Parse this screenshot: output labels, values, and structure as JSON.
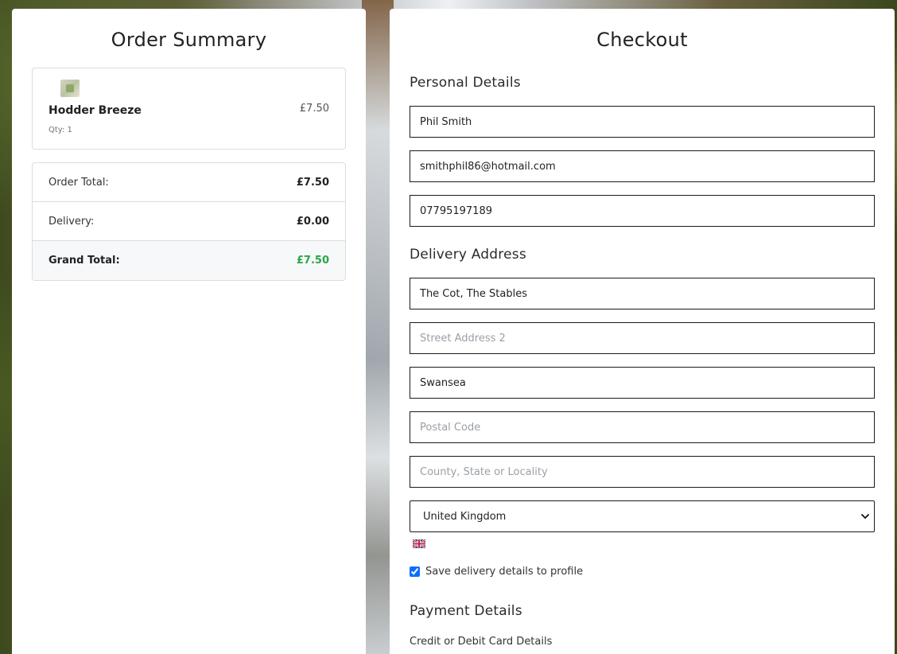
{
  "summary": {
    "title": "Order Summary",
    "item": {
      "name": "Hodder Breeze",
      "qty": "Qty: 1",
      "price": "£7.50"
    },
    "totals": {
      "order_total_label": "Order Total:",
      "order_total_value": "£7.50",
      "delivery_label": "Delivery:",
      "delivery_value": "£0.00",
      "grand_total_label": "Grand Total:",
      "grand_total_value": "£7.50"
    }
  },
  "checkout": {
    "title": "Checkout",
    "personal_heading": "Personal Details",
    "full_name": "Phil Smith",
    "email": "smithphil86@hotmail.com",
    "phone": "07795197189",
    "delivery_heading": "Delivery Address",
    "street1": "The Cot, The Stables",
    "street2_placeholder": "Street Address 2",
    "town": "Swansea",
    "postcode_placeholder": "Postal Code",
    "county_placeholder": "County, State or Locality",
    "country_selected": "United Kingdom",
    "save_label": "Save delivery details to profile",
    "payment_heading": "Payment Details",
    "card_label": "Credit or Debit Card Details"
  },
  "colors": {
    "grand_total": "#28a745",
    "checkbox": "#0d6efd"
  },
  "icons": {
    "flag": "uk-flag-icon",
    "select": "chevron-down-icon"
  }
}
